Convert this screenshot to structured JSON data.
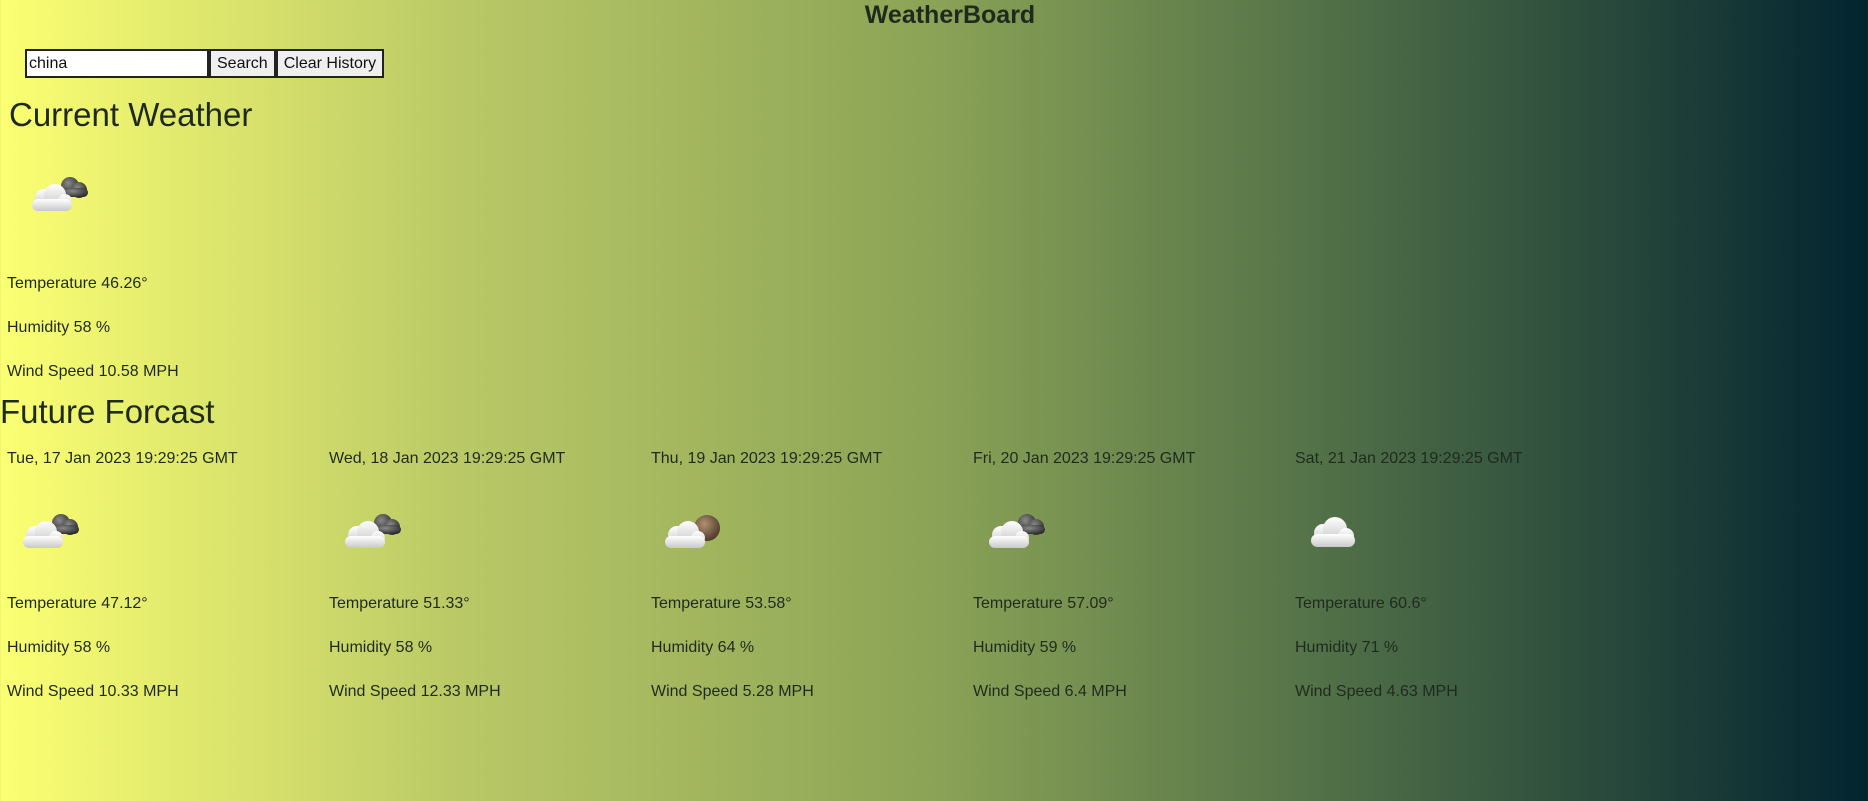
{
  "app": {
    "title": "WeatherBoard"
  },
  "search": {
    "value": "china",
    "search_label": "Search",
    "clear_label": "Clear History"
  },
  "current": {
    "heading": "Current Weather",
    "icon": "broken-clouds-icon",
    "temperature": "Temperature 46.26°",
    "humidity": "Humidity 58 %",
    "wind": "Wind Speed 10.58 MPH"
  },
  "forecast": {
    "heading": "Future Forcast",
    "days": [
      {
        "date": "Tue, 17 Jan 2023 19:29:25 GMT",
        "icon": "broken-clouds-icon",
        "temperature": "Temperature 47.12°",
        "humidity": "Humidity 58 %",
        "wind": "Wind Speed 10.33 MPH"
      },
      {
        "date": "Wed, 18 Jan 2023 19:29:25 GMT",
        "icon": "broken-clouds-icon",
        "temperature": "Temperature 51.33°",
        "humidity": "Humidity 58 %",
        "wind": "Wind Speed 12.33 MPH"
      },
      {
        "date": "Thu, 19 Jan 2023 19:29:25 GMT",
        "icon": "scattered-clouds-icon",
        "temperature": "Temperature 53.58°",
        "humidity": "Humidity 64 %",
        "wind": "Wind Speed 5.28 MPH"
      },
      {
        "date": "Fri, 20 Jan 2023 19:29:25 GMT",
        "icon": "broken-clouds-icon",
        "temperature": "Temperature 57.09°",
        "humidity": "Humidity 59 %",
        "wind": "Wind Speed 6.4 MPH"
      },
      {
        "date": "Sat, 21 Jan 2023 19:29:25 GMT",
        "icon": "cloud-icon",
        "temperature": "Temperature 60.6°",
        "humidity": "Humidity 71 %",
        "wind": "Wind Speed 4.63 MPH"
      }
    ]
  },
  "colors": {
    "gradient_start": "#fbff72",
    "gradient_end": "#022430",
    "text": "#1f2a1f"
  }
}
